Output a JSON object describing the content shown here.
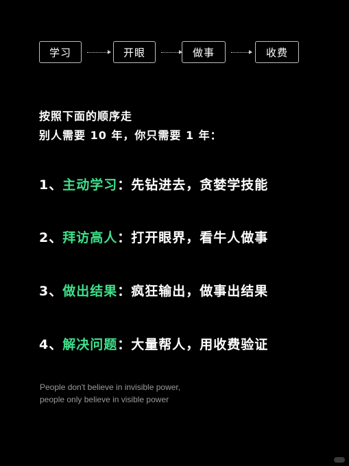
{
  "flow": {
    "steps": [
      "学习",
      "开眼",
      "做事",
      "收费"
    ]
  },
  "intro": {
    "line1": "按照下面的顺序走",
    "line2": "别人需要 10 年，你只需要 1 年："
  },
  "items": [
    {
      "num": "1、",
      "highlight": "主动学习",
      "colon": "：",
      "text": "先钻进去，贪婪学技能"
    },
    {
      "num": "2、",
      "highlight": "拜访高人",
      "colon": "：",
      "text": "打开眼界，看牛人做事"
    },
    {
      "num": "3、",
      "highlight": "做出结果",
      "colon": "：",
      "text": "疯狂输出，做事出结果"
    },
    {
      "num": "4、",
      "highlight": "解决问题",
      "colon": "：",
      "text": "大量帮人，用收费验证"
    }
  ],
  "quote": {
    "line1": "People don't believe in invisible power,",
    "line2": "people only believe in visible power"
  },
  "colors": {
    "background": "#000000",
    "accent": "#3fe08a",
    "text": "#ffffff",
    "muted": "#9a9a9a"
  }
}
